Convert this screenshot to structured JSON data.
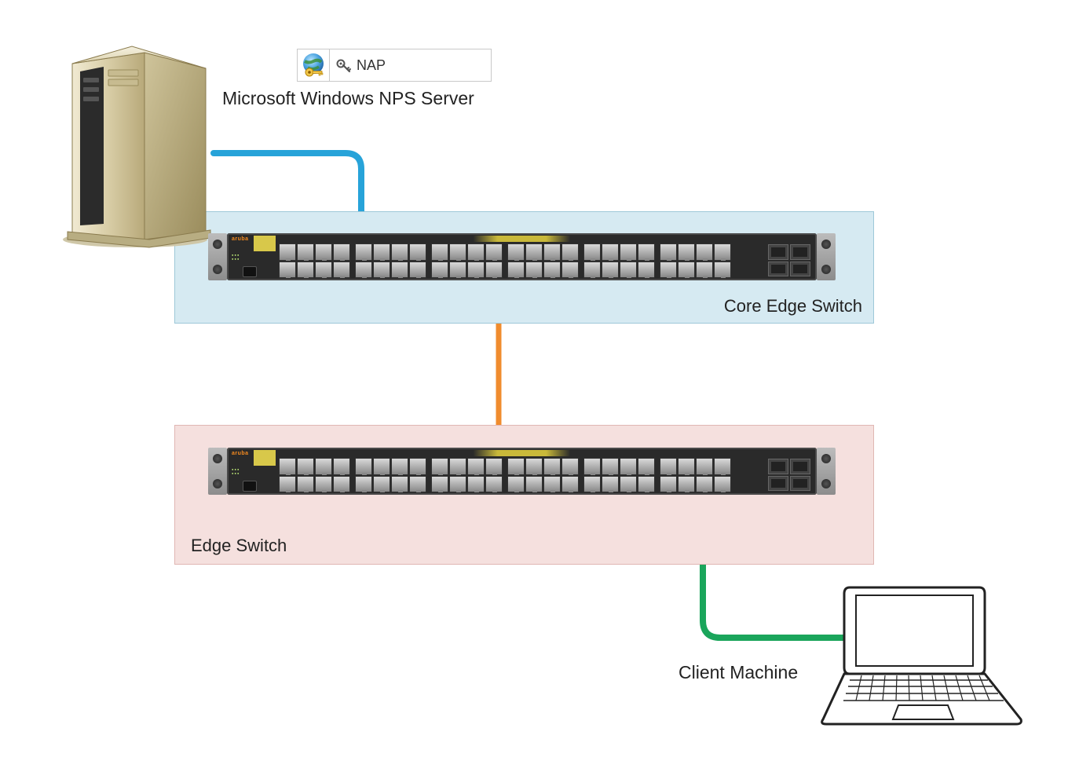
{
  "nap": {
    "label": "NAP"
  },
  "labels": {
    "server": "Microsoft Windows NPS Server",
    "core_switch": "Core Edge Switch",
    "edge_switch": "Edge Switch",
    "client": "Client Machine"
  },
  "switch": {
    "brand": "aruba"
  },
  "colors": {
    "cable_server_to_core": "#27a3d9",
    "cable_core_to_edge": "#f08c2e",
    "cable_edge_to_client": "#1aa55b",
    "core_zone_bg": "#d6eaf2",
    "edge_zone_bg": "#f5e0de"
  }
}
